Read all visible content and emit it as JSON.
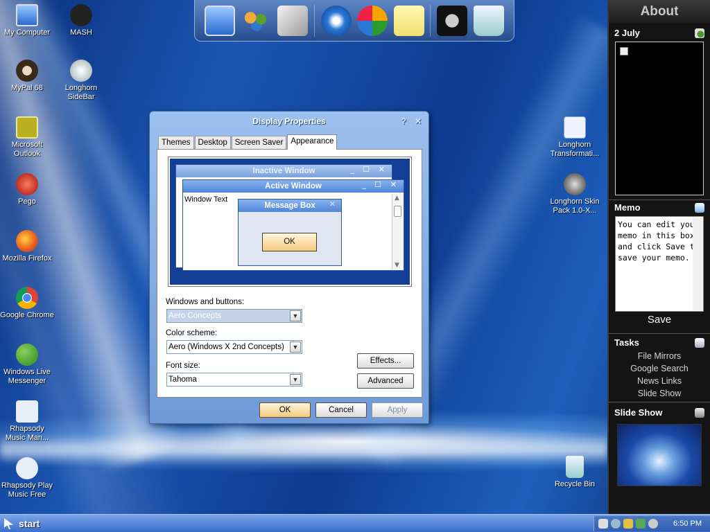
{
  "desktop": {
    "icons_left": [
      {
        "label": "My Computer",
        "icon": "my-computer-icon"
      },
      {
        "label": "MASH",
        "icon": "mash-icon"
      },
      {
        "label": "MyPal 68",
        "icon": "mypal-icon"
      },
      {
        "label": "Longhorn SideBar",
        "icon": "longhorn-sidebar-icon"
      },
      {
        "label": "Microsoft Outlook",
        "icon": "outlook-icon"
      },
      {
        "label": "Pego",
        "icon": "pego-icon"
      },
      {
        "label": "Mozilla Firefox",
        "icon": "firefox-icon"
      },
      {
        "label": "Google Chrome",
        "icon": "chrome-icon"
      },
      {
        "label": "Windows Live Messenger",
        "icon": "messenger-icon"
      },
      {
        "label": "Rhapsody Music Man...",
        "icon": "rhapsody-icon"
      },
      {
        "label": "Rhapsody Play Music Free",
        "icon": "rhapsody-play-icon"
      }
    ],
    "icons_right": [
      {
        "label": "Longhorn Transformati...",
        "icon": "longhorn-transformation-icon"
      },
      {
        "label": "Longhorn Skin Pack 1.0-X...",
        "icon": "longhorn-skin-pack-icon"
      },
      {
        "label": "Recycle Bin",
        "icon": "recycle-bin-icon"
      }
    ]
  },
  "dock": {
    "items": [
      "my-computer-icon",
      "users-icon",
      "scanner-icon",
      "internet-explorer-icon",
      "media-player-icon",
      "sticky-note-icon",
      "settings-icon",
      "recycle-bin-icon"
    ]
  },
  "dialog": {
    "title": "Display Properties",
    "help": "?",
    "close": "✕",
    "tabs": [
      "Themes",
      "Desktop",
      "Screen Saver",
      "Appearance"
    ],
    "active_tab": "Appearance",
    "preview": {
      "inactive_title": "Inactive Window",
      "active_title": "Active Window",
      "window_text": "Window Text",
      "message_title": "Message Box",
      "ok": "OK",
      "min": "_",
      "max": "☐",
      "x": "✕"
    },
    "windows_buttons": {
      "label": "Windows and buttons:",
      "value": "Aero Concepts"
    },
    "color_scheme": {
      "label": "Color scheme:",
      "value": "Aero (Windows X 2nd Concepts)"
    },
    "font_size": {
      "label": "Font size:",
      "value": "Tahoma"
    },
    "effects": "Effects...",
    "advanced": "Advanced",
    "ok": "OK",
    "cancel": "Cancel",
    "apply": "Apply"
  },
  "sidebar": {
    "title": "About",
    "date": "2 July",
    "memo_title": "Memo",
    "memo_text": "You can edit your memo in this box and click Save to save your memo.",
    "save": "Save",
    "tasks_title": "Tasks",
    "tasks": [
      "File Mirrors",
      "Google Search",
      "News Links",
      "Slide Show"
    ],
    "slideshow_title": "Slide Show"
  },
  "taskbar": {
    "start": "start",
    "clock": "6:50 PM"
  }
}
